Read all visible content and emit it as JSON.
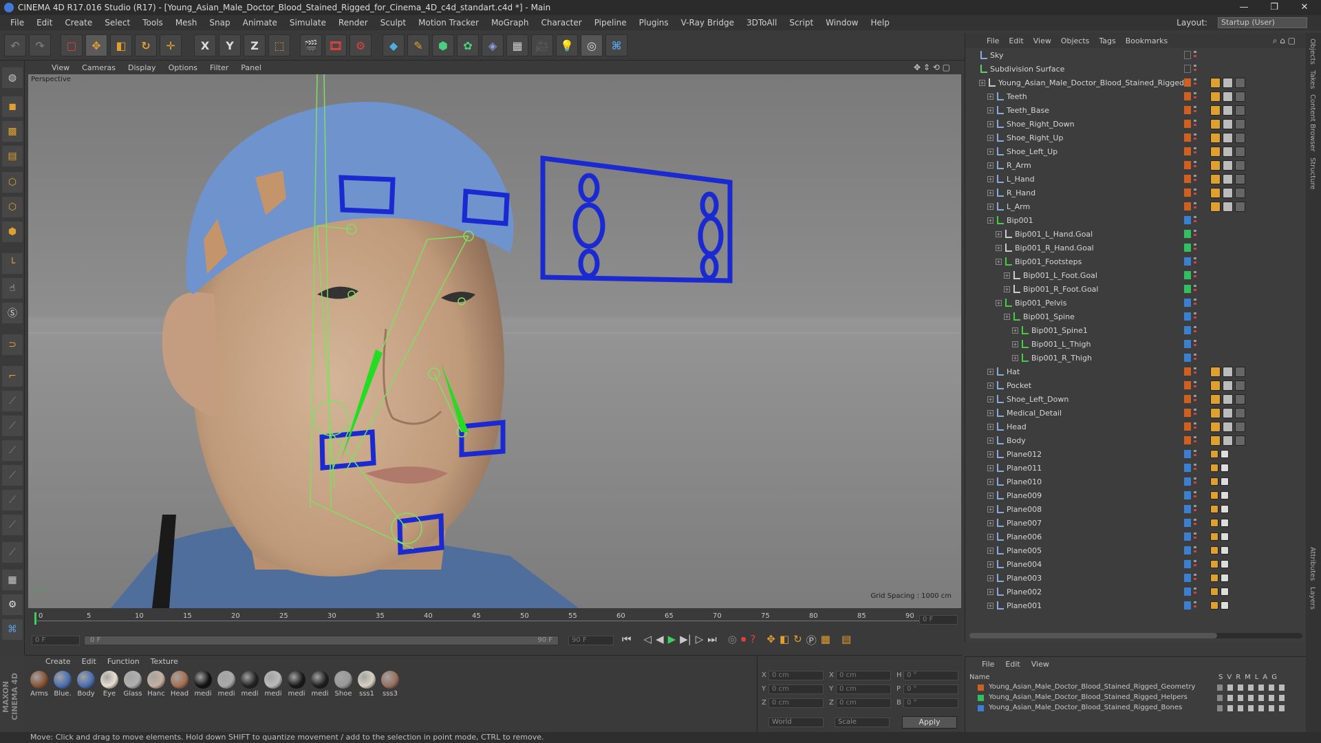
{
  "titlebar": {
    "title": "CINEMA 4D R17.016 Studio (R17) - [Young_Asian_Male_Doctor_Blood_Stained_Rigged_for_Cinema_4D_c4d_standart.c4d *] - Main",
    "min": "—",
    "max": "❐",
    "close": "✕"
  },
  "menubar": [
    "File",
    "Edit",
    "Create",
    "Select",
    "Tools",
    "Mesh",
    "Snap",
    "Animate",
    "Simulate",
    "Render",
    "Sculpt",
    "Motion Tracker",
    "MoGraph",
    "Character",
    "Pipeline",
    "Plugins",
    "V-Ray Bridge",
    "3DToAll",
    "Script",
    "Window",
    "Help"
  ],
  "layout": {
    "label": "Layout:",
    "value": "Startup (User)"
  },
  "toolbar": {
    "x": "X",
    "y": "Y",
    "z": "Z"
  },
  "viewport": {
    "menu": [
      "View",
      "Cameras",
      "Display",
      "Options",
      "Filter",
      "Panel"
    ],
    "label": "Perspective",
    "grid_spacing": "Grid Spacing : 1000 cm"
  },
  "timeline": {
    "ticks": [
      "0",
      "5",
      "10",
      "15",
      "20",
      "25",
      "30",
      "35",
      "40",
      "45",
      "50",
      "55",
      "60",
      "65",
      "70",
      "75",
      "80",
      "85",
      "90"
    ],
    "frame_right": "0 F",
    "cur_frame": "0 F",
    "range_start": "0 F",
    "range_end": "90 F",
    "end_frame": "90 F"
  },
  "materials": {
    "menu": [
      "Create",
      "Edit",
      "Function",
      "Texture"
    ],
    "items": [
      {
        "label": "Arms",
        "color": "#8a5535"
      },
      {
        "label": "Blue.",
        "color": "#4a6fb0"
      },
      {
        "label": "Body",
        "color": "#4a6fb0"
      },
      {
        "label": "Eye",
        "color": "#e8e0d0"
      },
      {
        "label": "Glass",
        "color": "#b0b0b0"
      },
      {
        "label": "Hanc",
        "color": "#c8b0a0"
      },
      {
        "label": "Head",
        "color": "#a87050"
      },
      {
        "label": "medi",
        "color": "#111111"
      },
      {
        "label": "medi",
        "color": "#aaaaaa"
      },
      {
        "label": "medi",
        "color": "#222222"
      },
      {
        "label": "medi",
        "color": "#bbbbbb"
      },
      {
        "label": "medi",
        "color": "#181818"
      },
      {
        "label": "medi",
        "color": "#1e1e1e"
      },
      {
        "label": "Shoe",
        "color": "#999999"
      },
      {
        "label": "sss1",
        "color": "#d8d0c0"
      },
      {
        "label": "sss3",
        "color": "#9a7060"
      }
    ]
  },
  "coords": {
    "rows": [
      {
        "a": "X",
        "av": "0 cm",
        "b": "X",
        "bv": "0 cm",
        "c": "H",
        "cv": "0 °"
      },
      {
        "a": "Y",
        "av": "0 cm",
        "b": "Y",
        "bv": "0 cm",
        "c": "P",
        "cv": "0 °"
      },
      {
        "a": "Z",
        "av": "0 cm",
        "b": "Z",
        "bv": "0 cm",
        "c": "B",
        "cv": "0 °"
      }
    ],
    "world": "World",
    "scale": "Scale",
    "apply": "Apply"
  },
  "status": "Move: Click and drag to move elements. Hold down SHIFT to quantize movement / add to the selection in point mode, CTRL to remove.",
  "objects": {
    "menu": [
      "File",
      "Edit",
      "View",
      "Objects",
      "Tags",
      "Bookmarks"
    ],
    "items": [
      {
        "name": "Sky",
        "lvl": 0,
        "ic": "#88aadd",
        "lay": "none"
      },
      {
        "name": "Subdivision Surface",
        "lvl": 0,
        "ic": "#66cc66",
        "lay": "none"
      },
      {
        "name": "Young_Asian_Male_Doctor_Blood_Stained_Rigged",
        "lvl": 1,
        "ic": "#cccccc",
        "lay": "#d06020"
      },
      {
        "name": "Teeth",
        "lvl": 2,
        "ic": "#88aadd",
        "lay": "#d06020"
      },
      {
        "name": "Teeth_Base",
        "lvl": 2,
        "ic": "#88aadd",
        "lay": "#d06020"
      },
      {
        "name": "Shoe_Right_Down",
        "lvl": 2,
        "ic": "#88aadd",
        "lay": "#d06020"
      },
      {
        "name": "Shoe_Right_Up",
        "lvl": 2,
        "ic": "#88aadd",
        "lay": "#d06020"
      },
      {
        "name": "Shoe_Left_Up",
        "lvl": 2,
        "ic": "#88aadd",
        "lay": "#d06020"
      },
      {
        "name": "R_Arm",
        "lvl": 2,
        "ic": "#88aadd",
        "lay": "#d06020"
      },
      {
        "name": "L_Hand",
        "lvl": 2,
        "ic": "#88aadd",
        "lay": "#d06020"
      },
      {
        "name": "R_Hand",
        "lvl": 2,
        "ic": "#88aadd",
        "lay": "#d06020"
      },
      {
        "name": "L_Arm",
        "lvl": 2,
        "ic": "#88aadd",
        "lay": "#d06020"
      },
      {
        "name": "Bip001",
        "lvl": 2,
        "ic": "#44cc44",
        "lay": "#3a80d0"
      },
      {
        "name": "Bip001_L_Hand.Goal",
        "lvl": 3,
        "ic": "#cccccc",
        "lay": "#30c060"
      },
      {
        "name": "Bip001_R_Hand.Goal",
        "lvl": 3,
        "ic": "#cccccc",
        "lay": "#30c060"
      },
      {
        "name": "Bip001_Footsteps",
        "lvl": 3,
        "ic": "#44cc44",
        "lay": "#3a80d0"
      },
      {
        "name": "Bip001_L_Foot.Goal",
        "lvl": 4,
        "ic": "#cccccc",
        "lay": "#30c060"
      },
      {
        "name": "Bip001_R_Foot.Goal",
        "lvl": 4,
        "ic": "#cccccc",
        "lay": "#30c060"
      },
      {
        "name": "Bip001_Pelvis",
        "lvl": 3,
        "ic": "#44cc44",
        "lay": "#3a80d0"
      },
      {
        "name": "Bip001_Spine",
        "lvl": 4,
        "ic": "#44cc44",
        "lay": "#3a80d0"
      },
      {
        "name": "Bip001_Spine1",
        "lvl": 5,
        "ic": "#44cc44",
        "lay": "#3a80d0"
      },
      {
        "name": "Bip001_L_Thigh",
        "lvl": 5,
        "ic": "#44cc44",
        "lay": "#3a80d0"
      },
      {
        "name": "Bip001_R_Thigh",
        "lvl": 5,
        "ic": "#44cc44",
        "lay": "#3a80d0"
      },
      {
        "name": "Hat",
        "lvl": 2,
        "ic": "#88aadd",
        "lay": "#d06020"
      },
      {
        "name": "Pocket",
        "lvl": 2,
        "ic": "#88aadd",
        "lay": "#d06020"
      },
      {
        "name": "Shoe_Left_Down",
        "lvl": 2,
        "ic": "#88aadd",
        "lay": "#d06020"
      },
      {
        "name": "Medical_Detail",
        "lvl": 2,
        "ic": "#88aadd",
        "lay": "#d06020"
      },
      {
        "name": "Head",
        "lvl": 2,
        "ic": "#88aadd",
        "lay": "#d06020"
      },
      {
        "name": "Body",
        "lvl": 2,
        "ic": "#88aadd",
        "lay": "#d06020"
      },
      {
        "name": "Plane012",
        "lvl": 2,
        "ic": "#88aadd",
        "lay": "#3a80d0"
      },
      {
        "name": "Plane011",
        "lvl": 2,
        "ic": "#88aadd",
        "lay": "#3a80d0"
      },
      {
        "name": "Plane010",
        "lvl": 2,
        "ic": "#88aadd",
        "lay": "#3a80d0"
      },
      {
        "name": "Plane009",
        "lvl": 2,
        "ic": "#88aadd",
        "lay": "#3a80d0"
      },
      {
        "name": "Plane008",
        "lvl": 2,
        "ic": "#88aadd",
        "lay": "#3a80d0"
      },
      {
        "name": "Plane007",
        "lvl": 2,
        "ic": "#88aadd",
        "lay": "#3a80d0"
      },
      {
        "name": "Plane006",
        "lvl": 2,
        "ic": "#88aadd",
        "lay": "#3a80d0"
      },
      {
        "name": "Plane005",
        "lvl": 2,
        "ic": "#88aadd",
        "lay": "#3a80d0"
      },
      {
        "name": "Plane004",
        "lvl": 2,
        "ic": "#88aadd",
        "lay": "#3a80d0"
      },
      {
        "name": "Plane003",
        "lvl": 2,
        "ic": "#88aadd",
        "lay": "#3a80d0"
      },
      {
        "name": "Plane002",
        "lvl": 2,
        "ic": "#88aadd",
        "lay": "#3a80d0"
      },
      {
        "name": "Plane001",
        "lvl": 2,
        "ic": "#88aadd",
        "lay": "#3a80d0"
      }
    ]
  },
  "layers": {
    "menu": [
      "File",
      "Edit",
      "View"
    ],
    "name_header": "Name",
    "cols": [
      "S",
      "V",
      "R",
      "M",
      "L",
      "A",
      "G"
    ],
    "items": [
      {
        "name": "Young_Asian_Male_Doctor_Blood_Stained_Rigged_Geometry",
        "color": "#d06020"
      },
      {
        "name": "Young_Asian_Male_Doctor_Blood_Stained_Rigged_Helpers",
        "color": "#30c060"
      },
      {
        "name": "Young_Asian_Male_Doctor_Blood_Stained_Rigged_Bones",
        "color": "#3a80d0"
      }
    ]
  },
  "side_tabs": [
    "Objects",
    "Takes",
    "Content Browser",
    "Structure",
    "Attributes",
    "Layers"
  ],
  "brand": "MAXON CINEMA 4D"
}
